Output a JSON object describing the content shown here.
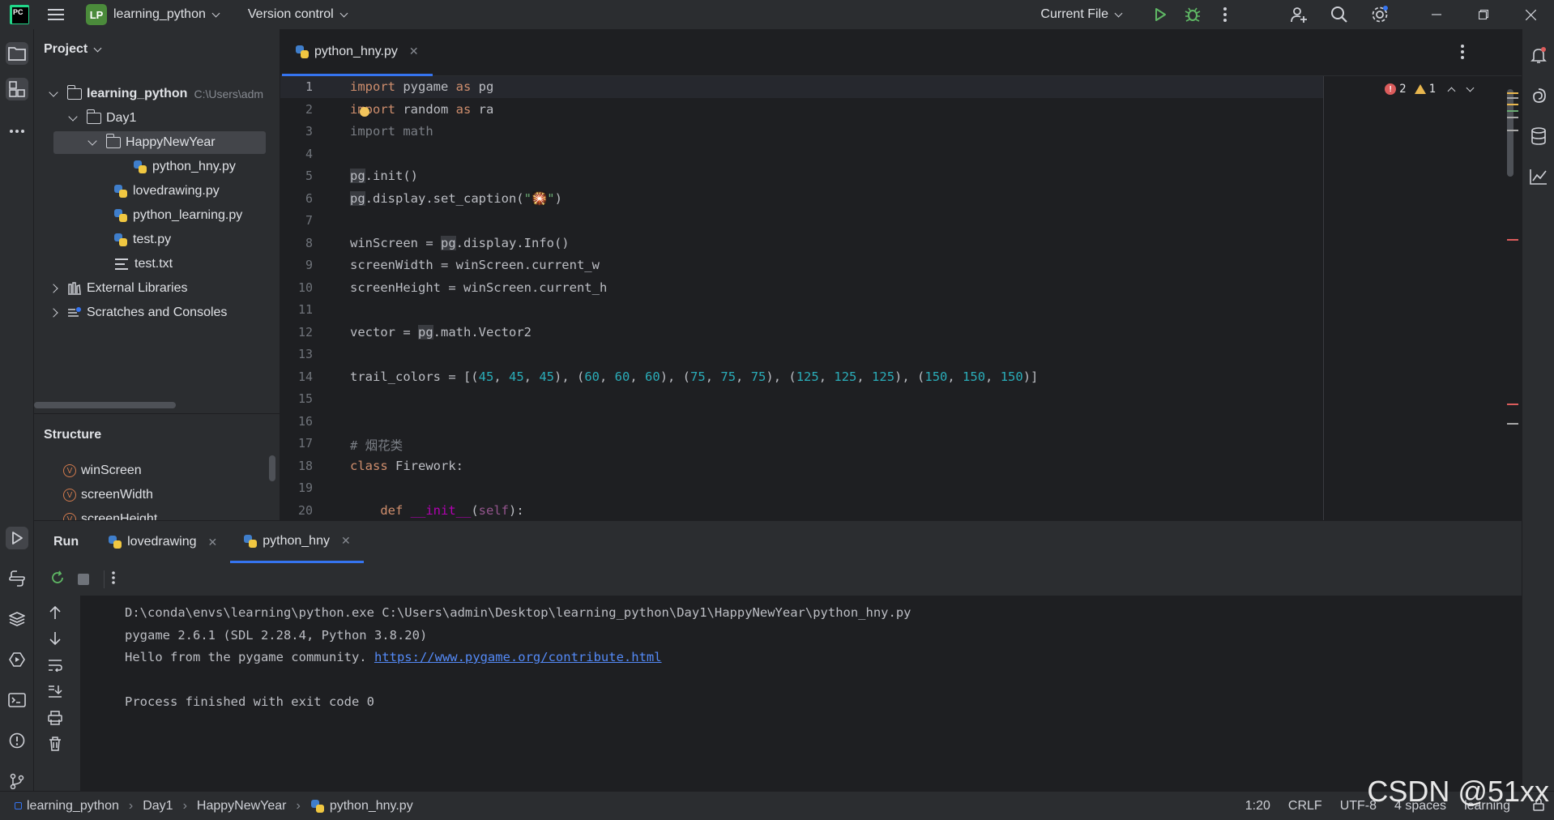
{
  "titlebar": {
    "project_badge": "LP",
    "project_name": "learning_python",
    "vcs": "Version control",
    "run_config": "Current File"
  },
  "project_panel": {
    "title": "Project",
    "tree": [
      {
        "label": "learning_python",
        "hint": "C:\\Users\\adm",
        "kind": "folder",
        "depth": 0,
        "expanded": true,
        "bold": true
      },
      {
        "label": "Day1",
        "kind": "folder",
        "depth": 1,
        "expanded": true
      },
      {
        "label": "HappyNewYear",
        "kind": "folder",
        "depth": 2,
        "expanded": true,
        "selected": true
      },
      {
        "label": "python_hny.py",
        "kind": "py",
        "depth": 3
      },
      {
        "label": "lovedrawing.py",
        "kind": "py",
        "depth": 2
      },
      {
        "label": "python_learning.py",
        "kind": "py",
        "depth": 2
      },
      {
        "label": "test.py",
        "kind": "py",
        "depth": 2
      },
      {
        "label": "test.txt",
        "kind": "txt",
        "depth": 2
      },
      {
        "label": "External Libraries",
        "kind": "lib",
        "depth": 0
      },
      {
        "label": "Scratches and Consoles",
        "kind": "scratch",
        "depth": 0
      }
    ]
  },
  "structure": {
    "title": "Structure",
    "items": [
      "winScreen",
      "screenWidth",
      "screenHeight"
    ]
  },
  "editor": {
    "tab": "python_hny.py",
    "errors": "2",
    "warnings": "1",
    "line_numbers": [
      "1",
      "2",
      "3",
      "4",
      "5",
      "6",
      "7",
      "8",
      "9",
      "10",
      "11",
      "12",
      "13",
      "14",
      "15",
      "16",
      "17",
      "18",
      "19",
      "20"
    ]
  },
  "run_panel": {
    "title": "Run",
    "tabs": [
      "lovedrawing",
      "python_hny"
    ],
    "console": [
      "D:\\conda\\envs\\learning\\python.exe C:\\Users\\admin\\Desktop\\learning_python\\Day1\\HappyNewYear\\python_hny.py",
      "pygame 2.6.1 (SDL 2.28.4, Python 3.8.20)",
      "Hello from the pygame community. ",
      "",
      "Process finished with exit code 0"
    ],
    "console_link": "https://www.pygame.org/contribute.html"
  },
  "statusbar": {
    "breadcrumbs": [
      "learning_python",
      "Day1",
      "HappyNewYear",
      "python_hny.py"
    ],
    "position": "1:20",
    "line_sep": "CRLF",
    "encoding": "UTF-8",
    "indent": "4 spaces",
    "interpreter": "learning"
  },
  "watermark": "CSDN @51xx",
  "colors": {
    "accent": "#3574f0",
    "error": "#db5c5c",
    "warning": "#e8b64e",
    "run_green": "#5fb865"
  }
}
